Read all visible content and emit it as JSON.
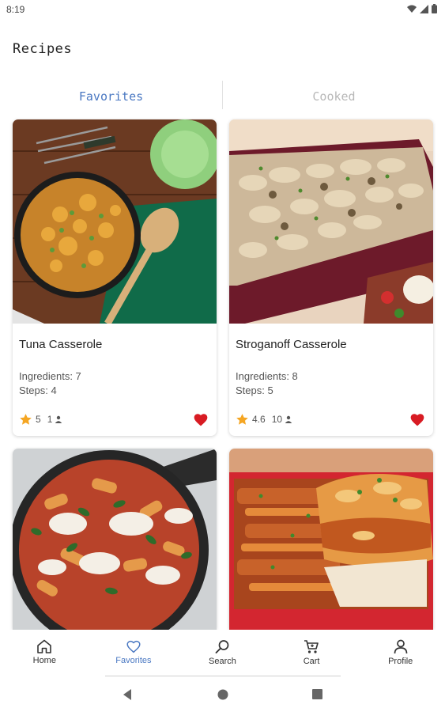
{
  "status_bar": {
    "time": "8:19"
  },
  "page": {
    "title": "Recipes"
  },
  "tabs": [
    {
      "label": "Favorites",
      "active": true
    },
    {
      "label": "Cooked",
      "active": false
    }
  ],
  "recipes": [
    {
      "title": "Tuna Casserole",
      "ingredients": "Ingredients: 7",
      "steps": "Steps: 4",
      "rating": "5",
      "cooked": "1",
      "favorite": true
    },
    {
      "title": "Stroganoff Casserole",
      "ingredients": "Ingredients: 8",
      "steps": "Steps: 5",
      "rating": "4.6",
      "cooked": "10",
      "favorite": true
    },
    {
      "title": "",
      "ingredients": "",
      "steps": "",
      "rating": "",
      "cooked": "",
      "favorite": true
    },
    {
      "title": "",
      "ingredients": "",
      "steps": "",
      "rating": "",
      "cooked": "",
      "favorite": true
    }
  ],
  "bottom_nav": [
    {
      "label": "Home",
      "icon": "home-icon",
      "active": false
    },
    {
      "label": "Favorites",
      "icon": "heart-outline-icon",
      "active": true
    },
    {
      "label": "Search",
      "icon": "search-icon",
      "active": false
    },
    {
      "label": "Cart",
      "icon": "cart-icon",
      "active": false
    },
    {
      "label": "Profile",
      "icon": "person-icon",
      "active": false
    }
  ],
  "colors": {
    "accent": "#4a78c2",
    "heart": "#d81b23",
    "star": "#f5a623",
    "inactive_tab": "#b8b8b8"
  }
}
